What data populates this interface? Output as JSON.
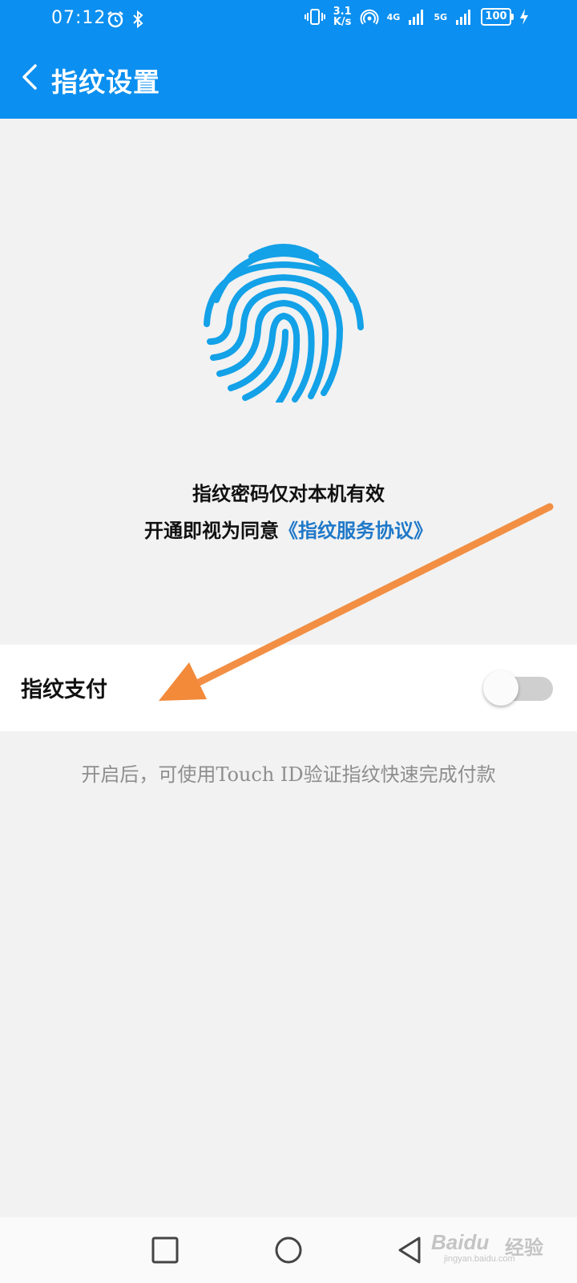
{
  "status_bar": {
    "time": "07:12",
    "speed_value": "3.1",
    "speed_unit": "K/s",
    "net1": "4G",
    "net2": "5G",
    "battery": "100",
    "icons": [
      "alarm-icon",
      "bluetooth-icon",
      "vibrate-icon",
      "hotspot-icon",
      "signal-icon",
      "charging-icon"
    ]
  },
  "header": {
    "title": "指纹设置",
    "back_icon": "chevron-left-icon",
    "background": "#0b8ff0"
  },
  "info": {
    "line1": "指纹密码仅对本机有效",
    "line2_prefix": "开通即视为同意",
    "agreement_link": "《指纹服务协议》",
    "link_color": "#1f78c8"
  },
  "fingerprint": {
    "icon": "fingerprint-icon",
    "color": "#13a1e8"
  },
  "toggle_row": {
    "label": "指纹支付",
    "enabled": false
  },
  "hint": "开启后，可使用Touch ID验证指纹快速完成付款",
  "annotation": {
    "arrow_color": "#f28a3a"
  },
  "nav_bar": {
    "buttons": [
      "recent-apps-icon",
      "home-icon",
      "back-triangle-icon"
    ]
  },
  "watermark": {
    "brand": "Baidu",
    "cn": "经验",
    "url": "jingyan.baidu.com"
  }
}
